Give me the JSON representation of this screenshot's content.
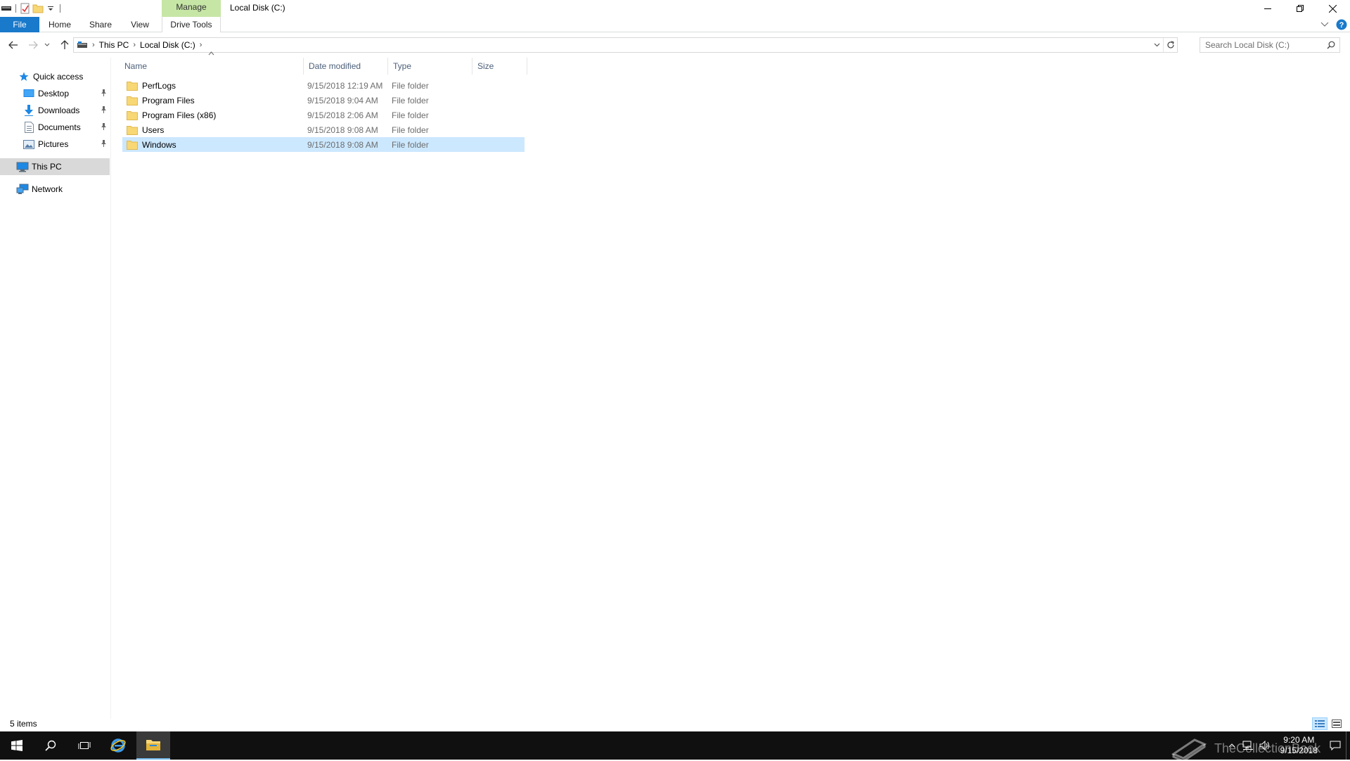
{
  "window": {
    "title": "Local Disk (C:)",
    "context_tab": "Manage"
  },
  "ribbon": {
    "tabs": [
      "File",
      "Home",
      "Share",
      "View",
      "Drive Tools"
    ]
  },
  "address": {
    "crumbs": [
      "This PC",
      "Local Disk (C:)"
    ],
    "search_placeholder": "Search Local Disk (C:)"
  },
  "nav": {
    "quick_access": "Quick access",
    "items": [
      {
        "label": "Desktop",
        "icon": "desktop-icon",
        "pinned": true
      },
      {
        "label": "Downloads",
        "icon": "downloads-icon",
        "pinned": true
      },
      {
        "label": "Documents",
        "icon": "documents-icon",
        "pinned": true
      },
      {
        "label": "Pictures",
        "icon": "pictures-icon",
        "pinned": true
      }
    ],
    "this_pc": "This PC",
    "network": "Network"
  },
  "columns": {
    "name": "Name",
    "date": "Date modified",
    "type": "Type",
    "size": "Size"
  },
  "files": [
    {
      "name": "PerfLogs",
      "date": "9/15/2018 12:19 AM",
      "type": "File folder"
    },
    {
      "name": "Program Files",
      "date": "9/15/2018 9:04 AM",
      "type": "File folder"
    },
    {
      "name": "Program Files (x86)",
      "date": "9/15/2018 2:06 AM",
      "type": "File folder"
    },
    {
      "name": "Users",
      "date": "9/15/2018 9:08 AM",
      "type": "File folder"
    },
    {
      "name": "Windows",
      "date": "9/15/2018 9:08 AM",
      "type": "File folder",
      "selected": true
    }
  ],
  "status": {
    "items_count": "5 items"
  },
  "taskbar": {
    "time": "9:20 AM",
    "date": "9/15/2018",
    "watermark": "TheCollectionBook"
  },
  "colors": {
    "accent": "#1979ca",
    "context_tab": "#c6e6a6",
    "selection": "#cce8ff",
    "folder": "#f8d775"
  }
}
